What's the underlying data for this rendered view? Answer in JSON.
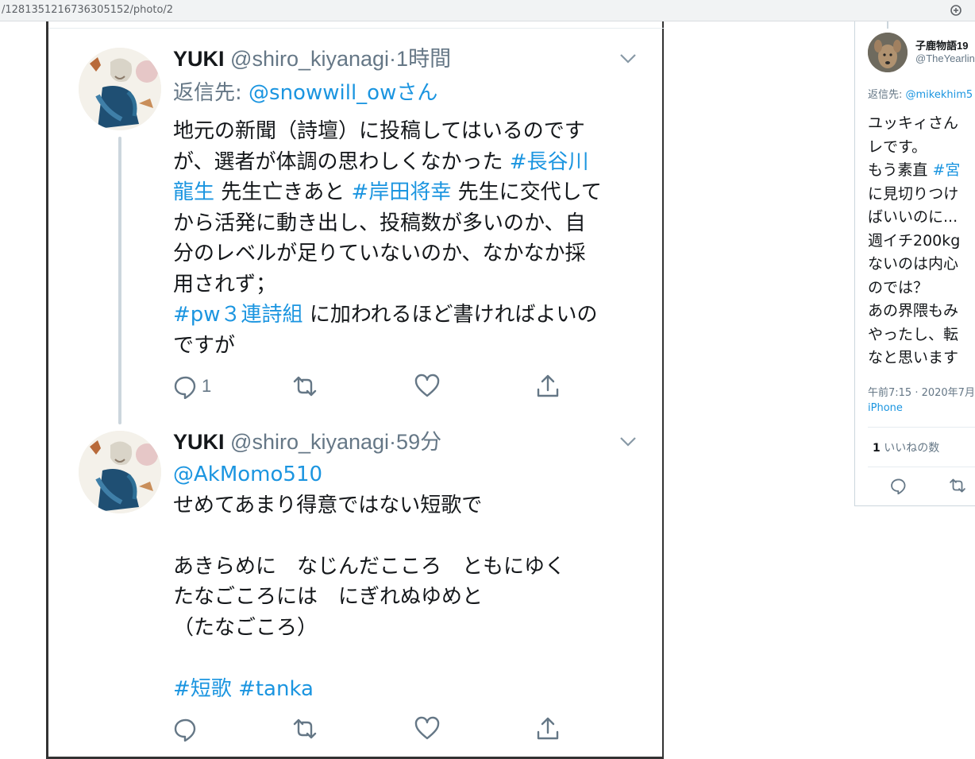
{
  "browser": {
    "url": "/1281351216736305152/photo/2",
    "zoom_icon": "zoom-in-icon"
  },
  "colors": {
    "link": "#1b95e0",
    "secondary_text": "#657786",
    "thread_line": "#ccd6dd"
  },
  "tweets": [
    {
      "name": "YUKI",
      "handle": "@shiro_kiyanagi",
      "separator": "·",
      "time": "1時間",
      "reply_prefix": "返信先: ",
      "reply_handle": "@snowwill_owさん",
      "body": [
        [
          {
            "t": "地元の新聞（詩壇）に投稿してはいるのです"
          }
        ],
        [
          {
            "t": "が、選者が体調の思わしくなかった "
          },
          {
            "t": "#長谷川",
            "link": true
          }
        ],
        [
          {
            "t": "龍生",
            "link": true
          },
          {
            "t": " 先生亡きあと "
          },
          {
            "t": "#岸田将幸",
            "link": true
          },
          {
            "t": " 先生に交代して"
          }
        ],
        [
          {
            "t": "から活発に動き出し、投稿数が多いのか、自"
          }
        ],
        [
          {
            "t": "分のレベルが足りていないのか、なかなか採"
          }
        ],
        [
          {
            "t": "用されず；"
          }
        ],
        [
          {
            "t": "#pw３連詩組",
            "link": true
          },
          {
            "t": " に加われるほど書ければよいの"
          }
        ],
        [
          {
            "t": "ですが"
          }
        ]
      ],
      "reply_count": "1",
      "icons": [
        "reply-icon",
        "retweet-icon",
        "like-icon",
        "share-icon"
      ]
    },
    {
      "name": "YUKI",
      "handle": "@shiro_kiyanagi",
      "separator": "·",
      "time": "59分",
      "body": [
        [
          {
            "t": "@AkMomo510",
            "link": true
          }
        ],
        [
          {
            "t": "せめてあまり得意ではない短歌で"
          }
        ],
        [
          {
            "t": ""
          }
        ],
        [
          {
            "t": "あきらめに　なじんだこころ　ともにゆく"
          }
        ],
        [
          {
            "t": "たなごころには　にぎれぬゆめと"
          }
        ],
        [
          {
            "t": "（たなごころ）"
          }
        ],
        [
          {
            "t": ""
          }
        ],
        [
          {
            "t": "#短歌",
            "link": true
          },
          {
            "t": " "
          },
          {
            "t": "#tanka",
            "link": true
          }
        ]
      ],
      "reply_count": "",
      "icons": [
        "reply-icon",
        "retweet-icon",
        "like-icon",
        "share-icon"
      ]
    }
  ],
  "side_tweet": {
    "name": "子鹿物語19",
    "handle": "@TheYearlin",
    "reply_prefix": "返信先: ",
    "reply_handle": "@mikekhim5",
    "body": [
      [
        {
          "t": "ユッキィさん"
        }
      ],
      [
        {
          "t": "レです。"
        }
      ],
      [
        {
          "t": "もう素直 "
        },
        {
          "t": "#宮",
          "link": true
        }
      ],
      [
        {
          "t": "に見切りつけ"
        }
      ],
      [
        {
          "t": "ばいいのに..."
        }
      ],
      [
        {
          "t": "週イチ200kg"
        }
      ],
      [
        {
          "t": "ないのは内心"
        }
      ],
      [
        {
          "t": "のでは？"
        }
      ],
      [
        {
          "t": "あの界隈もみ"
        }
      ],
      [
        {
          "t": "やったし、転"
        }
      ],
      [
        {
          "t": "なと思います"
        }
      ]
    ],
    "timestamp": "午前7:15 · 2020年7月",
    "source": "iPhone",
    "likes_count": "1",
    "likes_label": " いいねの数"
  }
}
